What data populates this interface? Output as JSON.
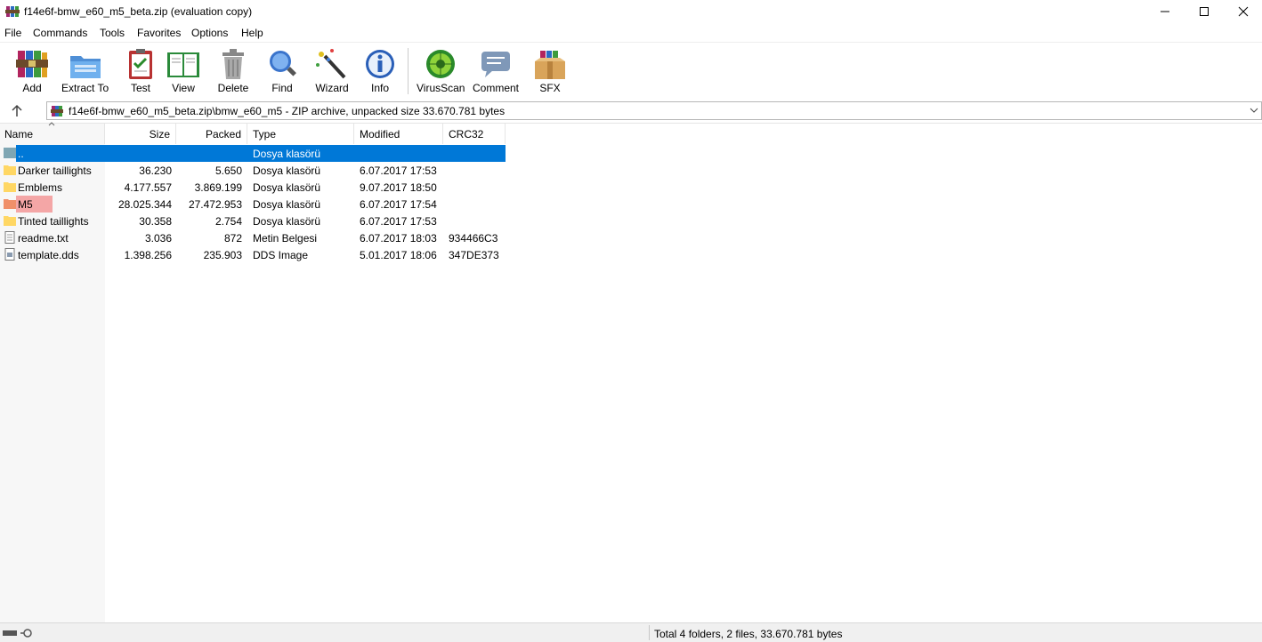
{
  "window": {
    "title": "f14e6f-bmw_e60_m5_beta.zip (evaluation copy)"
  },
  "menu": [
    "File",
    "Commands",
    "Tools",
    "Favorites",
    "Options",
    "Help"
  ],
  "toolbar": [
    {
      "label": "Add",
      "icon": "add-books-icon"
    },
    {
      "label": "Extract To",
      "icon": "extract-folder-icon"
    },
    {
      "label": "Test",
      "icon": "test-clipboard-icon"
    },
    {
      "label": "View",
      "icon": "view-book-icon"
    },
    {
      "label": "Delete",
      "icon": "trash-icon"
    },
    {
      "label": "Find",
      "icon": "magnifier-icon"
    },
    {
      "label": "Wizard",
      "icon": "magic-wand-icon"
    },
    {
      "label": "Info",
      "icon": "info-icon"
    },
    {
      "label": "VirusScan",
      "icon": "virus-scan-icon"
    },
    {
      "label": "Comment",
      "icon": "comment-icon"
    },
    {
      "label": "SFX",
      "icon": "sfx-box-icon"
    }
  ],
  "address": {
    "path": "f14e6f-bmw_e60_m5_beta.zip\\bmw_e60_m5 - ZIP archive, unpacked size 33.670.781 bytes"
  },
  "columns": {
    "name": "Name",
    "size": "Size",
    "packed": "Packed",
    "type": "Type",
    "modified": "Modified",
    "crc": "CRC32"
  },
  "rows": [
    {
      "name": "..",
      "size": "",
      "packed": "",
      "type": "Dosya klasörü",
      "modified": "",
      "crc": "",
      "icon": "parent-folder-icon"
    },
    {
      "name": "Darker taillights",
      "size": "36.230",
      "packed": "5.650",
      "type": "Dosya klasörü",
      "modified": "6.07.2017 17:53",
      "crc": "",
      "icon": "folder-icon"
    },
    {
      "name": "Emblems",
      "size": "4.177.557",
      "packed": "3.869.199",
      "type": "Dosya klasörü",
      "modified": "9.07.2017 18:50",
      "crc": "",
      "icon": "folder-icon"
    },
    {
      "name": "M5",
      "size": "28.025.344",
      "packed": "27.472.953",
      "type": "Dosya klasörü",
      "modified": "6.07.2017 17:54",
      "crc": "",
      "icon": "folder-icon"
    },
    {
      "name": "Tinted taillights",
      "size": "30.358",
      "packed": "2.754",
      "type": "Dosya klasörü",
      "modified": "6.07.2017 17:53",
      "crc": "",
      "icon": "folder-icon"
    },
    {
      "name": "readme.txt",
      "size": "3.036",
      "packed": "872",
      "type": "Metin Belgesi",
      "modified": "6.07.2017 18:03",
      "crc": "934466C3",
      "icon": "text-file-icon"
    },
    {
      "name": "template.dds",
      "size": "1.398.256",
      "packed": "235.903",
      "type": "DDS Image",
      "modified": "5.01.2017 18:06",
      "crc": "347DE373",
      "icon": "image-file-icon"
    }
  ],
  "status": {
    "summary": "Total 4 folders, 2 files, 33.670.781 bytes"
  },
  "colors": {
    "selection": "#0078d7",
    "highlight": "#f4a6a6",
    "folder": "#ffd764"
  }
}
